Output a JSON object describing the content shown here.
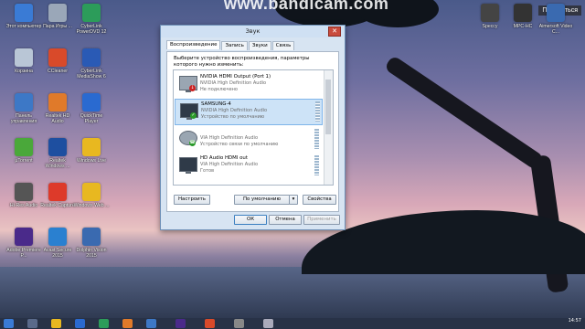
{
  "watermark": "www.bandicam.com",
  "share_label": "Поделиться",
  "desktop_icons_left": [
    {
      "label": "Этот компьютер",
      "color": "#3a7bd5"
    },
    {
      "label": "Пара Игры ...",
      "color": "#9aa7b8"
    },
    {
      "label": "CyberLink PowerDVD 12",
      "color": "#2c9c5a"
    },
    {
      "label": "Корзина",
      "color": "#b9c6d6"
    },
    {
      "label": "CCleaner",
      "color": "#d94a2a"
    },
    {
      "label": "CyberLink MediaShow 6",
      "color": "#2a5ab5"
    },
    {
      "label": "Панель управления",
      "color": "#3d78c6"
    },
    {
      "label": "Realtek HD Audio",
      "color": "#e07a2a"
    },
    {
      "label": "QuickTime Player",
      "color": "#2a6ad0"
    },
    {
      "label": "µTorrent",
      "color": "#4aa83a"
    },
    {
      "label": "Realtek Windows ...",
      "color": "#1e4fa0"
    },
    {
      "label": "Windows Live",
      "color": "#e8b820"
    },
    {
      "label": "Hi-Res Audio",
      "color": "#555"
    },
    {
      "label": "Realtek Capture",
      "color": "#dd3a2a"
    },
    {
      "label": "Windows Web ...",
      "color": "#e8b820"
    },
    {
      "label": "Adobe Premiere P...",
      "color": "#4a2a8a"
    },
    {
      "label": "Avast Secure 2015",
      "color": "#2a80d0"
    },
    {
      "label": "Dolphin Vision 2015",
      "color": "#3a6ab0"
    }
  ],
  "desktop_icons_right": [
    {
      "label": "Speccy",
      "color": "#444"
    },
    {
      "label": "MPC-HC",
      "color": "#333"
    },
    {
      "label": "Aimersoft Video C...",
      "color": "#3a6ab0"
    }
  ],
  "dialog": {
    "title": "Звук",
    "close_symbol": "✕",
    "tabs": [
      "Воспроизведение",
      "Запись",
      "Звуки",
      "Связь"
    ],
    "instruction": "Выберите устройство воспроизведения, параметры которого нужно изменить:",
    "devices": [
      {
        "name": "NVIDIA HDMI Output (Port 1)",
        "driver": "NVIDIA High Definition Audio",
        "status": "Не подключено",
        "badge": "↓"
      },
      {
        "name": "SAMSUNG-4",
        "driver": "NVIDIA High Definition Audio",
        "status": "Устройство по умолчанию",
        "badge": "✓"
      },
      {
        "name": "",
        "driver": "VIA High Definition Audio",
        "status": "Устройство связи по умолчанию",
        "badge": "☎"
      },
      {
        "name": "HD Audio HDMI out",
        "driver": "VIA High Definition Audio",
        "status": "Готов",
        "badge": ""
      }
    ],
    "buttons": {
      "configure": "Настроить",
      "set_default": "По умолчанию",
      "dropdown": "▾",
      "properties": "Свойства",
      "ok": "ОК",
      "cancel": "Отмена",
      "apply": "Применить"
    }
  },
  "taskbar": {
    "clock_time": "14:57"
  }
}
